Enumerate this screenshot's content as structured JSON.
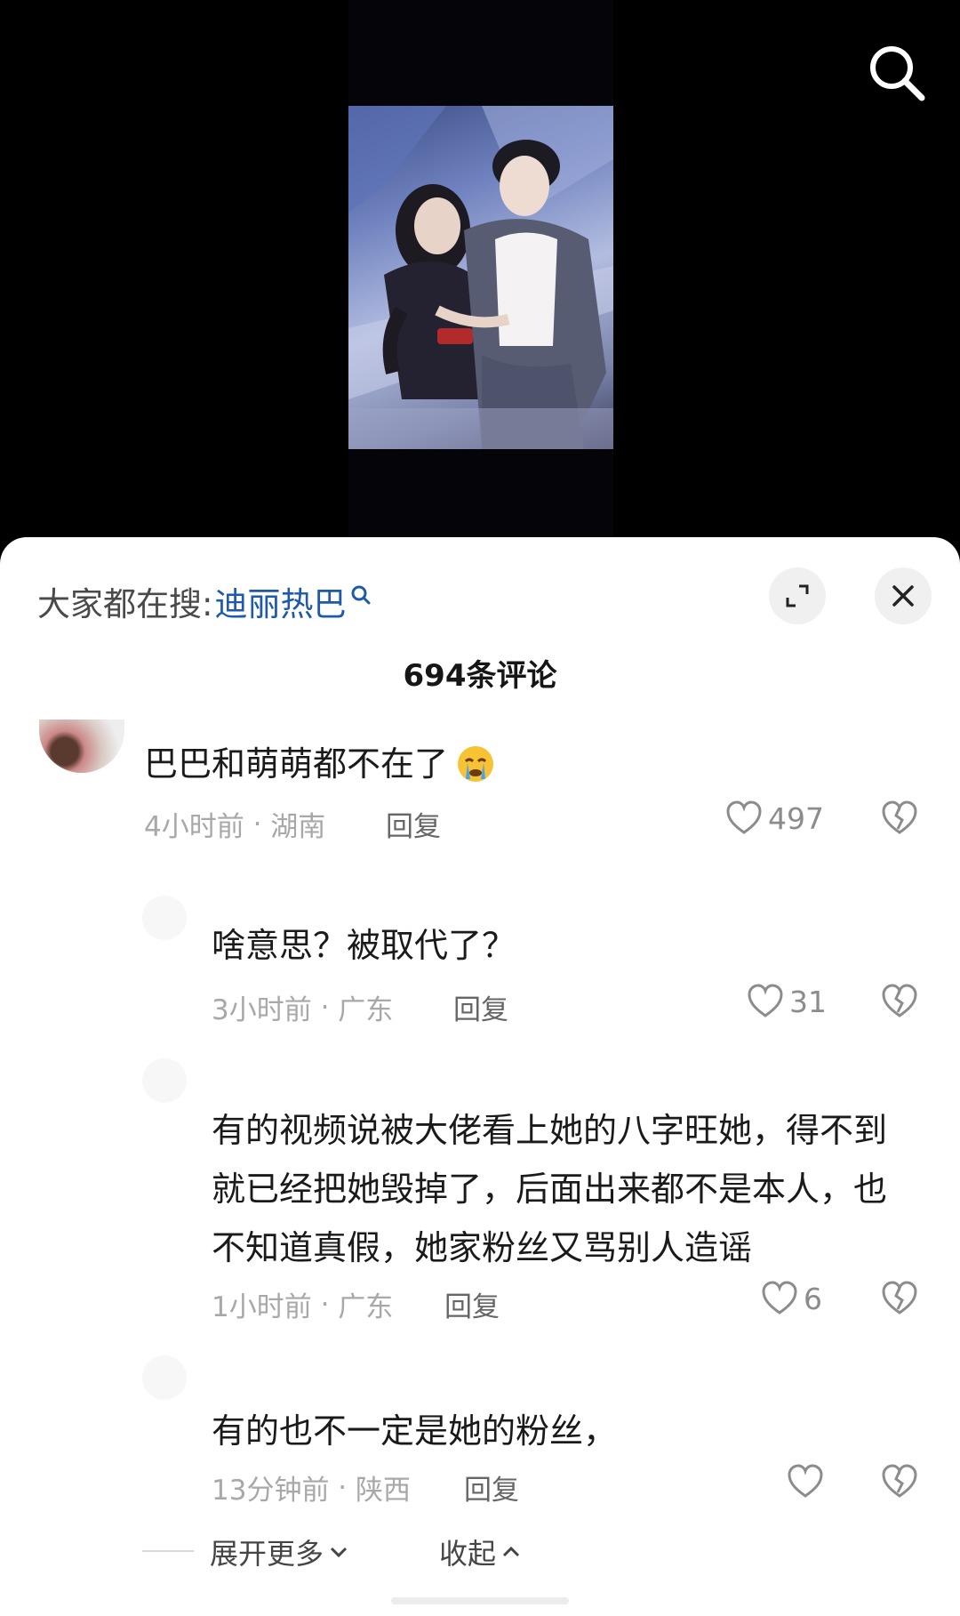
{
  "header": {
    "search_icon": "search-icon"
  },
  "video": {
    "thumbnail": "two-people-stage-photo"
  },
  "sheet": {
    "trending_prefix": "大家都在搜:",
    "trending_term": "迪丽热巴",
    "expand_icon": "expand-icon",
    "close_icon": "close-icon",
    "comment_count": "694条评论"
  },
  "comments": [
    {
      "text": "巴巴和萌萌都不在了",
      "emoji": "crying-emoji",
      "time": "4小时前",
      "location": "湖南",
      "reply_label": "回复",
      "likes": "497"
    },
    {
      "text": "啥意思？被取代了？",
      "time": "3小时前",
      "location": "广东",
      "reply_label": "回复",
      "likes": "31"
    },
    {
      "text_lines": [
        "有的视频说被大佬看上她的八字旺她，得不到",
        "就已经把她毁掉了，后面出来都不是本人，也",
        "不知道真假，她家粉丝又骂别人造谣"
      ],
      "time": "1小时前",
      "location": "广东",
      "reply_label": "回复",
      "likes": "6"
    },
    {
      "text": "有的也不一定是她的粉丝，",
      "time": "13分钟前",
      "location": "陕西",
      "reply_label": "回复",
      "likes": ""
    }
  ],
  "footer": {
    "expand_more": "展开更多",
    "collapse": "收起"
  },
  "colors": {
    "link": "#1f5aa8",
    "meta": "#a8a8a8",
    "text": "#1a1a1a"
  }
}
